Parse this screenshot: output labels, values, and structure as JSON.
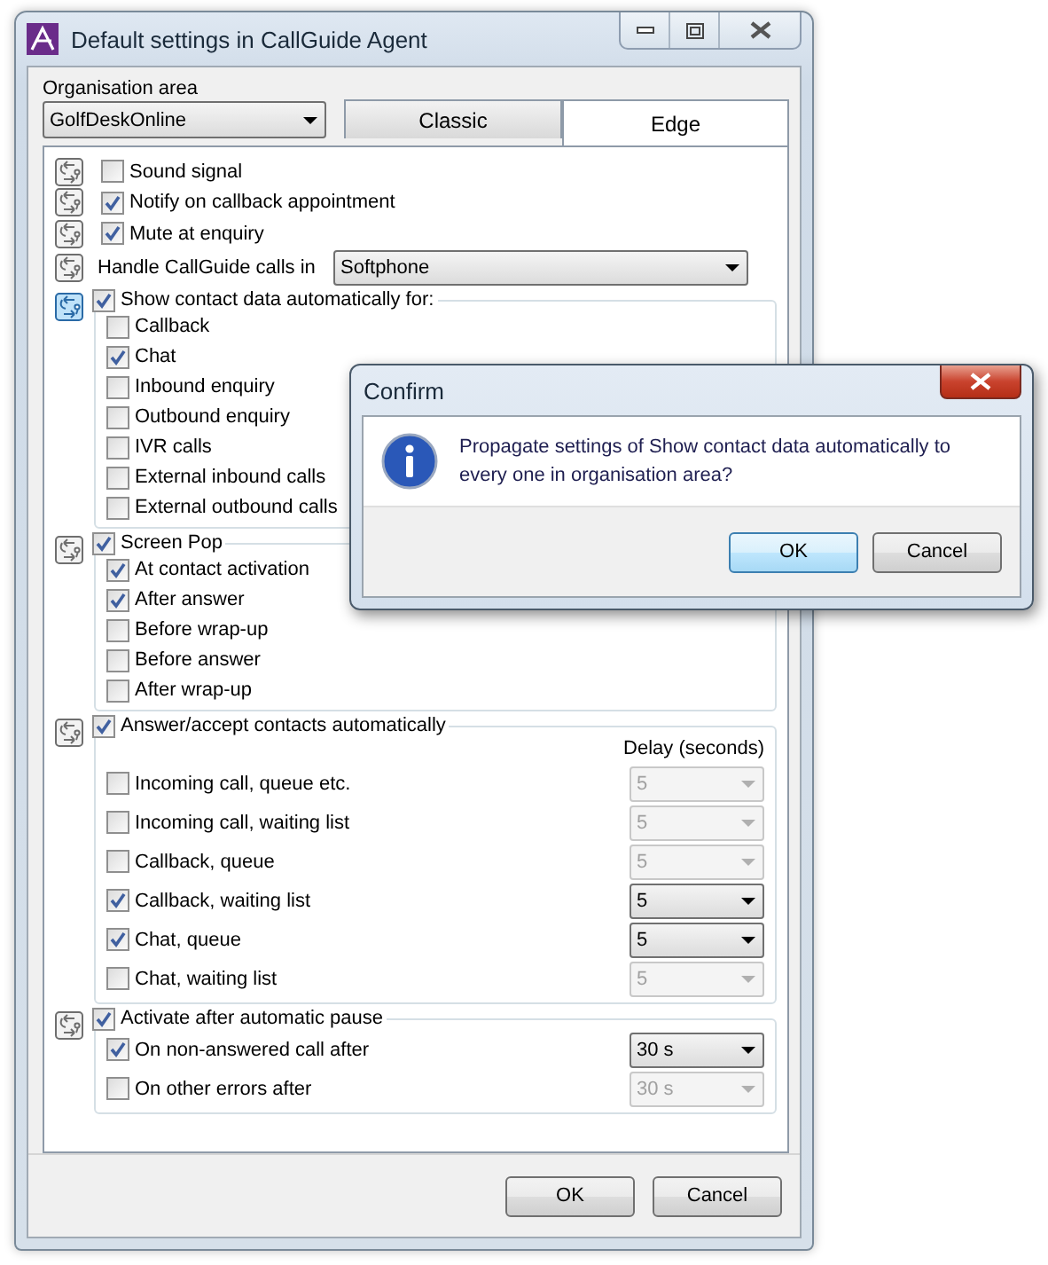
{
  "window": {
    "title": "Default settings in CallGuide Agent"
  },
  "organisation_area": {
    "label": "Organisation area",
    "value": "GolfDeskOnline"
  },
  "tabs": [
    {
      "label": "Classic",
      "selected": false
    },
    {
      "label": "Edge",
      "selected": true
    }
  ],
  "settings": [
    {
      "kind": "checkbox",
      "label": "Sound signal",
      "checked": false,
      "propagate_highlighted": false
    },
    {
      "kind": "checkbox",
      "label": "Notify on callback appointment",
      "checked": true,
      "propagate_highlighted": false
    },
    {
      "kind": "checkbox",
      "label": "Mute at enquiry",
      "checked": true,
      "propagate_highlighted": false
    },
    {
      "kind": "dropdown",
      "label": "Handle CallGuide calls in",
      "value": "Softphone",
      "propagate_highlighted": false
    }
  ],
  "groups": [
    {
      "label": "Show contact data automatically for:",
      "checked": true,
      "propagate_highlighted": true,
      "items": [
        {
          "label": "Callback",
          "checked": false
        },
        {
          "label": "Chat",
          "checked": true
        },
        {
          "label": "Inbound enquiry",
          "checked": false
        },
        {
          "label": "Outbound enquiry",
          "checked": false
        },
        {
          "label": "IVR calls",
          "checked": false
        },
        {
          "label": "External inbound calls",
          "checked": false
        },
        {
          "label": "External outbound calls",
          "checked": false
        }
      ]
    },
    {
      "label": "Screen Pop",
      "checked": true,
      "propagate_highlighted": false,
      "items": [
        {
          "label": "At contact activation",
          "checked": true
        },
        {
          "label": "After answer",
          "checked": true
        },
        {
          "label": "Before wrap-up",
          "checked": false
        },
        {
          "label": "Before answer",
          "checked": false
        },
        {
          "label": "After wrap-up",
          "checked": false
        }
      ]
    },
    {
      "label": "Answer/accept contacts automatically",
      "checked": true,
      "propagate_highlighted": false,
      "column_header": "Delay (seconds)",
      "items": [
        {
          "label": "Incoming call, queue etc.",
          "checked": false,
          "delay": "5"
        },
        {
          "label": "Incoming call, waiting list",
          "checked": false,
          "delay": "5"
        },
        {
          "label": "Callback, queue",
          "checked": false,
          "delay": "5"
        },
        {
          "label": "Callback, waiting list",
          "checked": true,
          "delay": "5"
        },
        {
          "label": "Chat, queue",
          "checked": true,
          "delay": "5"
        },
        {
          "label": "Chat, waiting list",
          "checked": false,
          "delay": "5"
        }
      ]
    },
    {
      "label": "Activate after automatic pause",
      "checked": true,
      "propagate_highlighted": false,
      "items": [
        {
          "label": "On non-answered call after",
          "checked": true,
          "delay": "30 s"
        },
        {
          "label": "On other errors after",
          "checked": false,
          "delay": "30 s"
        }
      ]
    }
  ],
  "buttons": [
    "OK",
    "Cancel"
  ],
  "confirm": {
    "title": "Confirm",
    "message": "Propagate settings of Show contact data automatically to every one in organisation area?",
    "buttons": [
      {
        "label": "OK",
        "focused": true
      },
      {
        "label": "Cancel",
        "focused": false
      }
    ]
  }
}
